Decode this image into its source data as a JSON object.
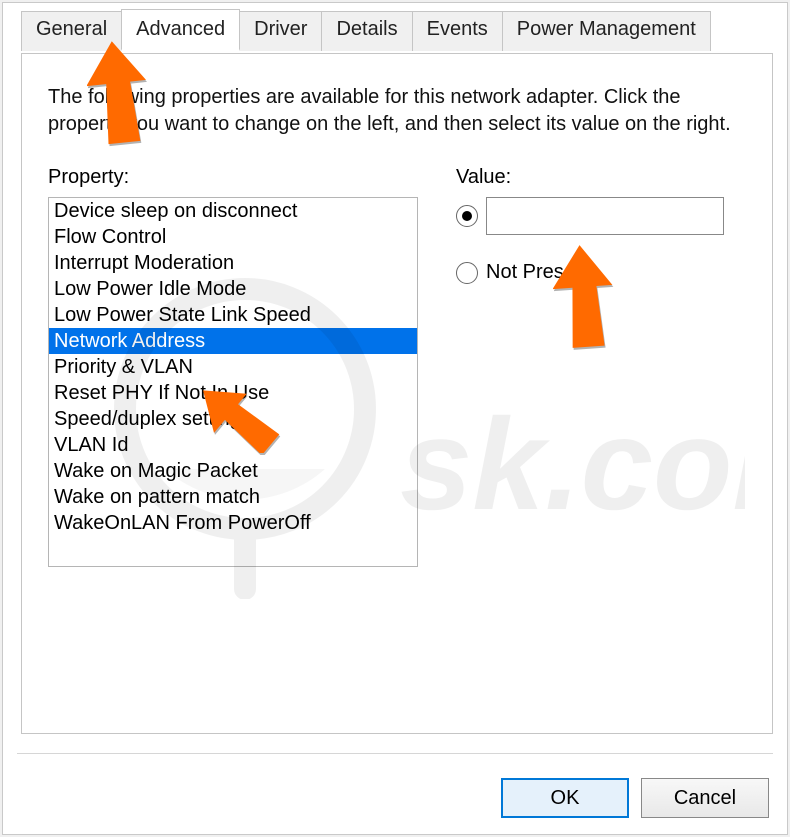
{
  "tabs": {
    "general": "General",
    "advanced": "Advanced",
    "driver": "Driver",
    "details": "Details",
    "events": "Events",
    "power": "Power Management"
  },
  "instructions": "The following properties are available for this network adapter. Click the property you want to change on the left, and then select its value on the right.",
  "labels": {
    "property": "Property:",
    "value": "Value:",
    "not_present": "Not Present"
  },
  "property_items": [
    "Device sleep on disconnect",
    "Flow Control",
    "Interrupt Moderation",
    "Low Power Idle Mode",
    "Low Power State Link Speed",
    "Network Address",
    "Priority & VLAN",
    "Reset PHY If Not In Use",
    "Speed/duplex settings",
    "VLAN Id",
    "Wake on Magic Packet",
    "Wake on pattern match",
    "WakeOnLAN From PowerOff"
  ],
  "selected_index": 5,
  "value_input": "",
  "radio_selected": "value",
  "buttons": {
    "ok": "OK",
    "cancel": "Cancel"
  },
  "watermark_text": "PCrisk.com"
}
